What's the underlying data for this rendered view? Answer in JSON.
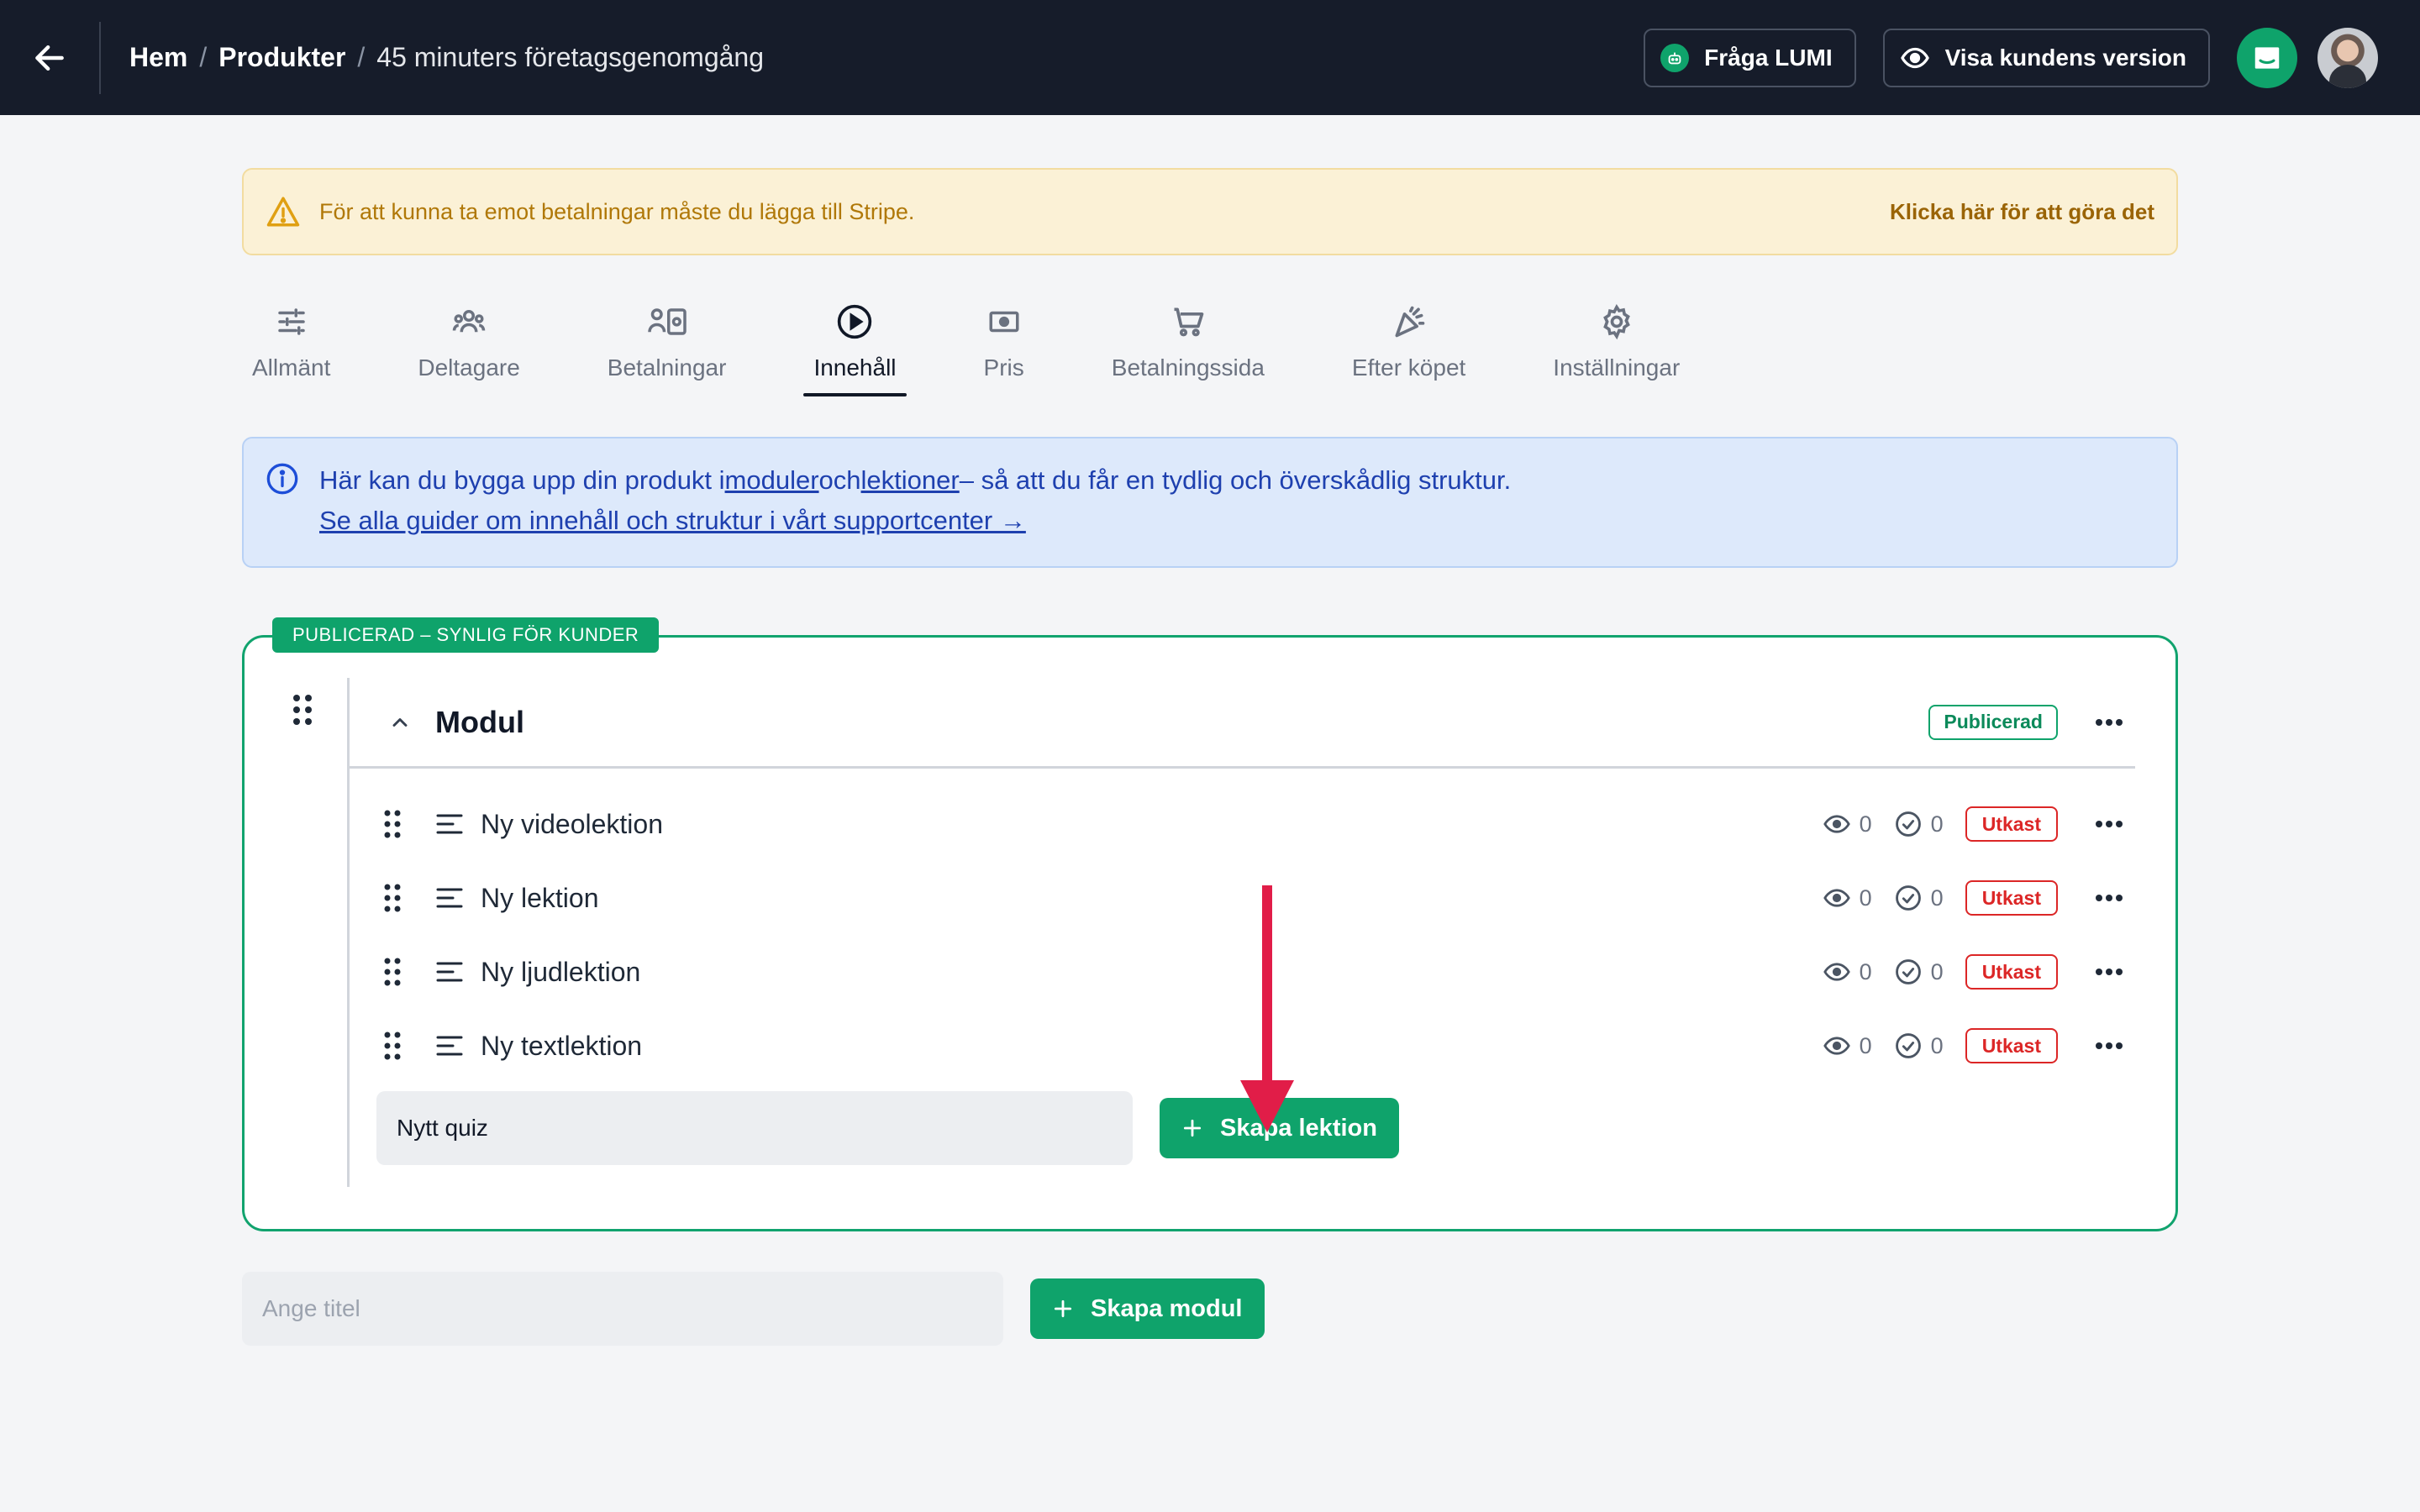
{
  "topbar": {
    "breadcrumb": [
      "Hem",
      "Produkter",
      "45 minuters företagsgenomgång"
    ],
    "ask_lumi": "Fråga LUMI",
    "customer_view": "Visa kundens version"
  },
  "warning": {
    "text": "För att kunna ta emot betalningar måste du lägga till Stripe.",
    "link": "Klicka här för att göra det"
  },
  "tabs": [
    {
      "label": "Allmänt",
      "icon": "sliders-icon"
    },
    {
      "label": "Deltagare",
      "icon": "users-icon"
    },
    {
      "label": "Betalningar",
      "icon": "payments-icon"
    },
    {
      "label": "Innehåll",
      "icon": "play-circle-icon",
      "active": true
    },
    {
      "label": "Pris",
      "icon": "banknote-icon"
    },
    {
      "label": "Betalningssida",
      "icon": "cart-icon"
    },
    {
      "label": "Efter köpet",
      "icon": "party-icon"
    },
    {
      "label": "Inställningar",
      "icon": "gear-icon"
    }
  ],
  "info": {
    "line1_pre": "Här kan du bygga upp din produkt i",
    "line1_modules": "moduler",
    "line1_and": "och",
    "line1_lessons": "lektioner",
    "line1_post": "– så att du får en tydlig och överskådlig struktur.",
    "line2": "Se alla guider om innehåll och struktur i vårt supportcenter →"
  },
  "module": {
    "status_label": "PUBLICERAD – SYNLIG FÖR KUNDER",
    "title": "Modul",
    "badge": "Publicerad",
    "lessons": [
      {
        "title": "Ny videolektion",
        "views": "0",
        "completions": "0",
        "status": "Utkast"
      },
      {
        "title": "Ny lektion",
        "views": "0",
        "completions": "0",
        "status": "Utkast"
      },
      {
        "title": "Ny ljudlektion",
        "views": "0",
        "completions": "0",
        "status": "Utkast"
      },
      {
        "title": "Ny textlektion",
        "views": "0",
        "completions": "0",
        "status": "Utkast"
      }
    ],
    "quiz_value": "Nytt quiz",
    "create_lesson": "Skapa lektion"
  },
  "new_module": {
    "placeholder": "Ange titel",
    "create_module": "Skapa modul"
  },
  "colors": {
    "topbar": "#161c2a",
    "accent_green": "#0fa36b",
    "draft_red": "#dc2626",
    "arrow": "#e11d48"
  }
}
